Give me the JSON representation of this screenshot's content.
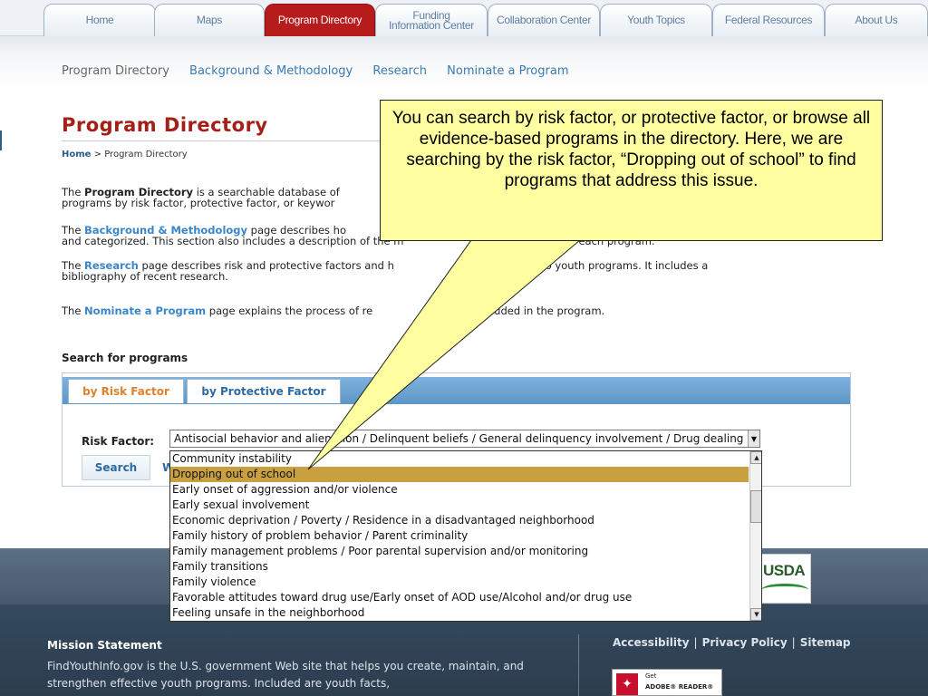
{
  "nav": {
    "home": "Home",
    "maps": "Maps",
    "program_directory": "Program Directory",
    "funding_line1": "Funding",
    "funding_line2": "Information Center",
    "collaboration": "Collaboration Center",
    "youth_topics": "Youth Topics",
    "federal_resources": "Federal Resources",
    "about_us": "About Us"
  },
  "subnav": {
    "program_directory": "Program Directory",
    "background": "Background & Methodology",
    "research": "Research",
    "nominate": "Nominate a Program"
  },
  "page": {
    "title": "Program Directory",
    "breadcrumb_home": "Home",
    "breadcrumb_sep": " > ",
    "breadcrumb_current": "Program Directory"
  },
  "paragraphs": {
    "p1_a": "The ",
    "p1_b": "Program Directory",
    "p1_c": " is a searchable database of",
    "p1_line2": "programs by risk factor, protective factor, or keywor",
    "p2_a": "The ",
    "p2_link": "Background & Methodology",
    "p2_b": " page describes ho",
    "p2_line2": "and categorized. This section also includes a description of the m",
    "p2_line2_end": "ssigned to each program.",
    "p3_a": "The ",
    "p3_link": "Research",
    "p3_b": " page describes risk and protective factors and h",
    "p3_b_end": "re relevant to youth programs. It includes a",
    "p3_line2": "bibliography of recent research.",
    "p4_a": "The ",
    "p4_link": "Nominate a Program",
    "p4_b": " page explains the process of re",
    "p4_b_end": "gram be included in the program."
  },
  "search": {
    "heading": "Search for programs",
    "tab_risk": "by Risk Factor",
    "tab_protective": "by Protective Factor",
    "risk_label": "Risk Factor:",
    "selected_value": "Antisocial behavior and alienation / Delinquent beliefs / General delinquency involvement / Drug dealing",
    "search_button": "Search",
    "w_char": "W",
    "options": [
      "Community instability",
      "Dropping out of school",
      "Early onset of aggression and/or violence",
      "Early sexual involvement",
      "Economic deprivation / Poverty / Residence in a disadvantaged neighborhood",
      "Family history of problem behavior / Parent criminality",
      "Family management problems / Poor parental supervision and/or monitoring",
      "Family transitions",
      "Family violence",
      "Favorable attitudes toward drug use/Early onset of AOD use/Alcohol and/or drug use",
      "Feeling unsafe in the neighborhood"
    ],
    "highlighted_index": 1
  },
  "callout": {
    "text": "You can search by risk factor, or protective factor, or browse all evidence-based programs in the directory. Here, we are searching by the risk factor, “Dropping out of school” to find programs that address this issue.",
    "background": "#fefea0"
  },
  "footer": {
    "usda": "USDA",
    "mission_title": "Mission Statement",
    "mission_text": "FindYouthInfo.gov is the U.S. government Web site that helps you create, maintain, and strengthen effective youth programs. Included are youth facts,",
    "accessibility": "Accessibility",
    "privacy": "Privacy Policy",
    "sitemap": "Sitemap",
    "sep": "|",
    "adobe_get": "Get",
    "adobe_reader": "ADOBE® READER®"
  },
  "colors": {
    "accent_red": "#b71c1c",
    "link_blue": "#3a86c8",
    "tab_orange": "#e2802a",
    "highlight": "#c8a040"
  }
}
